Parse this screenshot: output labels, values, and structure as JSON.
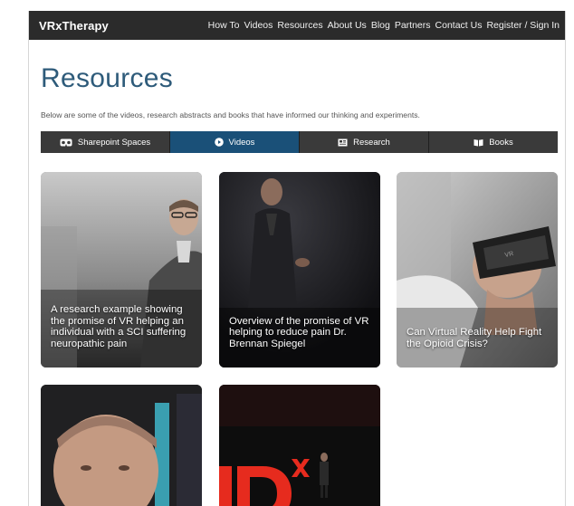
{
  "header": {
    "brand": "VRxTherapy",
    "nav": [
      "How To",
      "Videos",
      "Resources",
      "About Us",
      "Blog",
      "Partners",
      "Contact Us",
      "Register / Sign In"
    ]
  },
  "main": {
    "title": "Resources",
    "intro": "Below are some of the videos, research abstracts and books that have informed our thinking and experiments.",
    "tabs": [
      {
        "label": "Sharepoint Spaces",
        "icon": "vr-headset-icon",
        "active": false
      },
      {
        "label": "Videos",
        "icon": "play-circle-icon",
        "active": true
      },
      {
        "label": "Research",
        "icon": "newspaper-icon",
        "active": false
      },
      {
        "label": "Books",
        "icon": "book-icon",
        "active": false
      }
    ],
    "videos": [
      {
        "caption": "A research example showing the promise of VR helping an individual with a SCI suffering neuropathic pain"
      },
      {
        "caption": "Overview of the promise of VR helping to reduce pain Dr. Brennan Spiegel"
      },
      {
        "caption": "Can Virtual Reality Help Fight the Opioid Crisis?"
      },
      {
        "caption": ""
      },
      {
        "caption": ""
      }
    ]
  },
  "colors": {
    "navbar": "#2b2b2b",
    "tab_bg": "#3a3a3a",
    "tab_active": "#1a5078",
    "title": "#2e5b7a",
    "ted_red": "#e62b1e"
  }
}
